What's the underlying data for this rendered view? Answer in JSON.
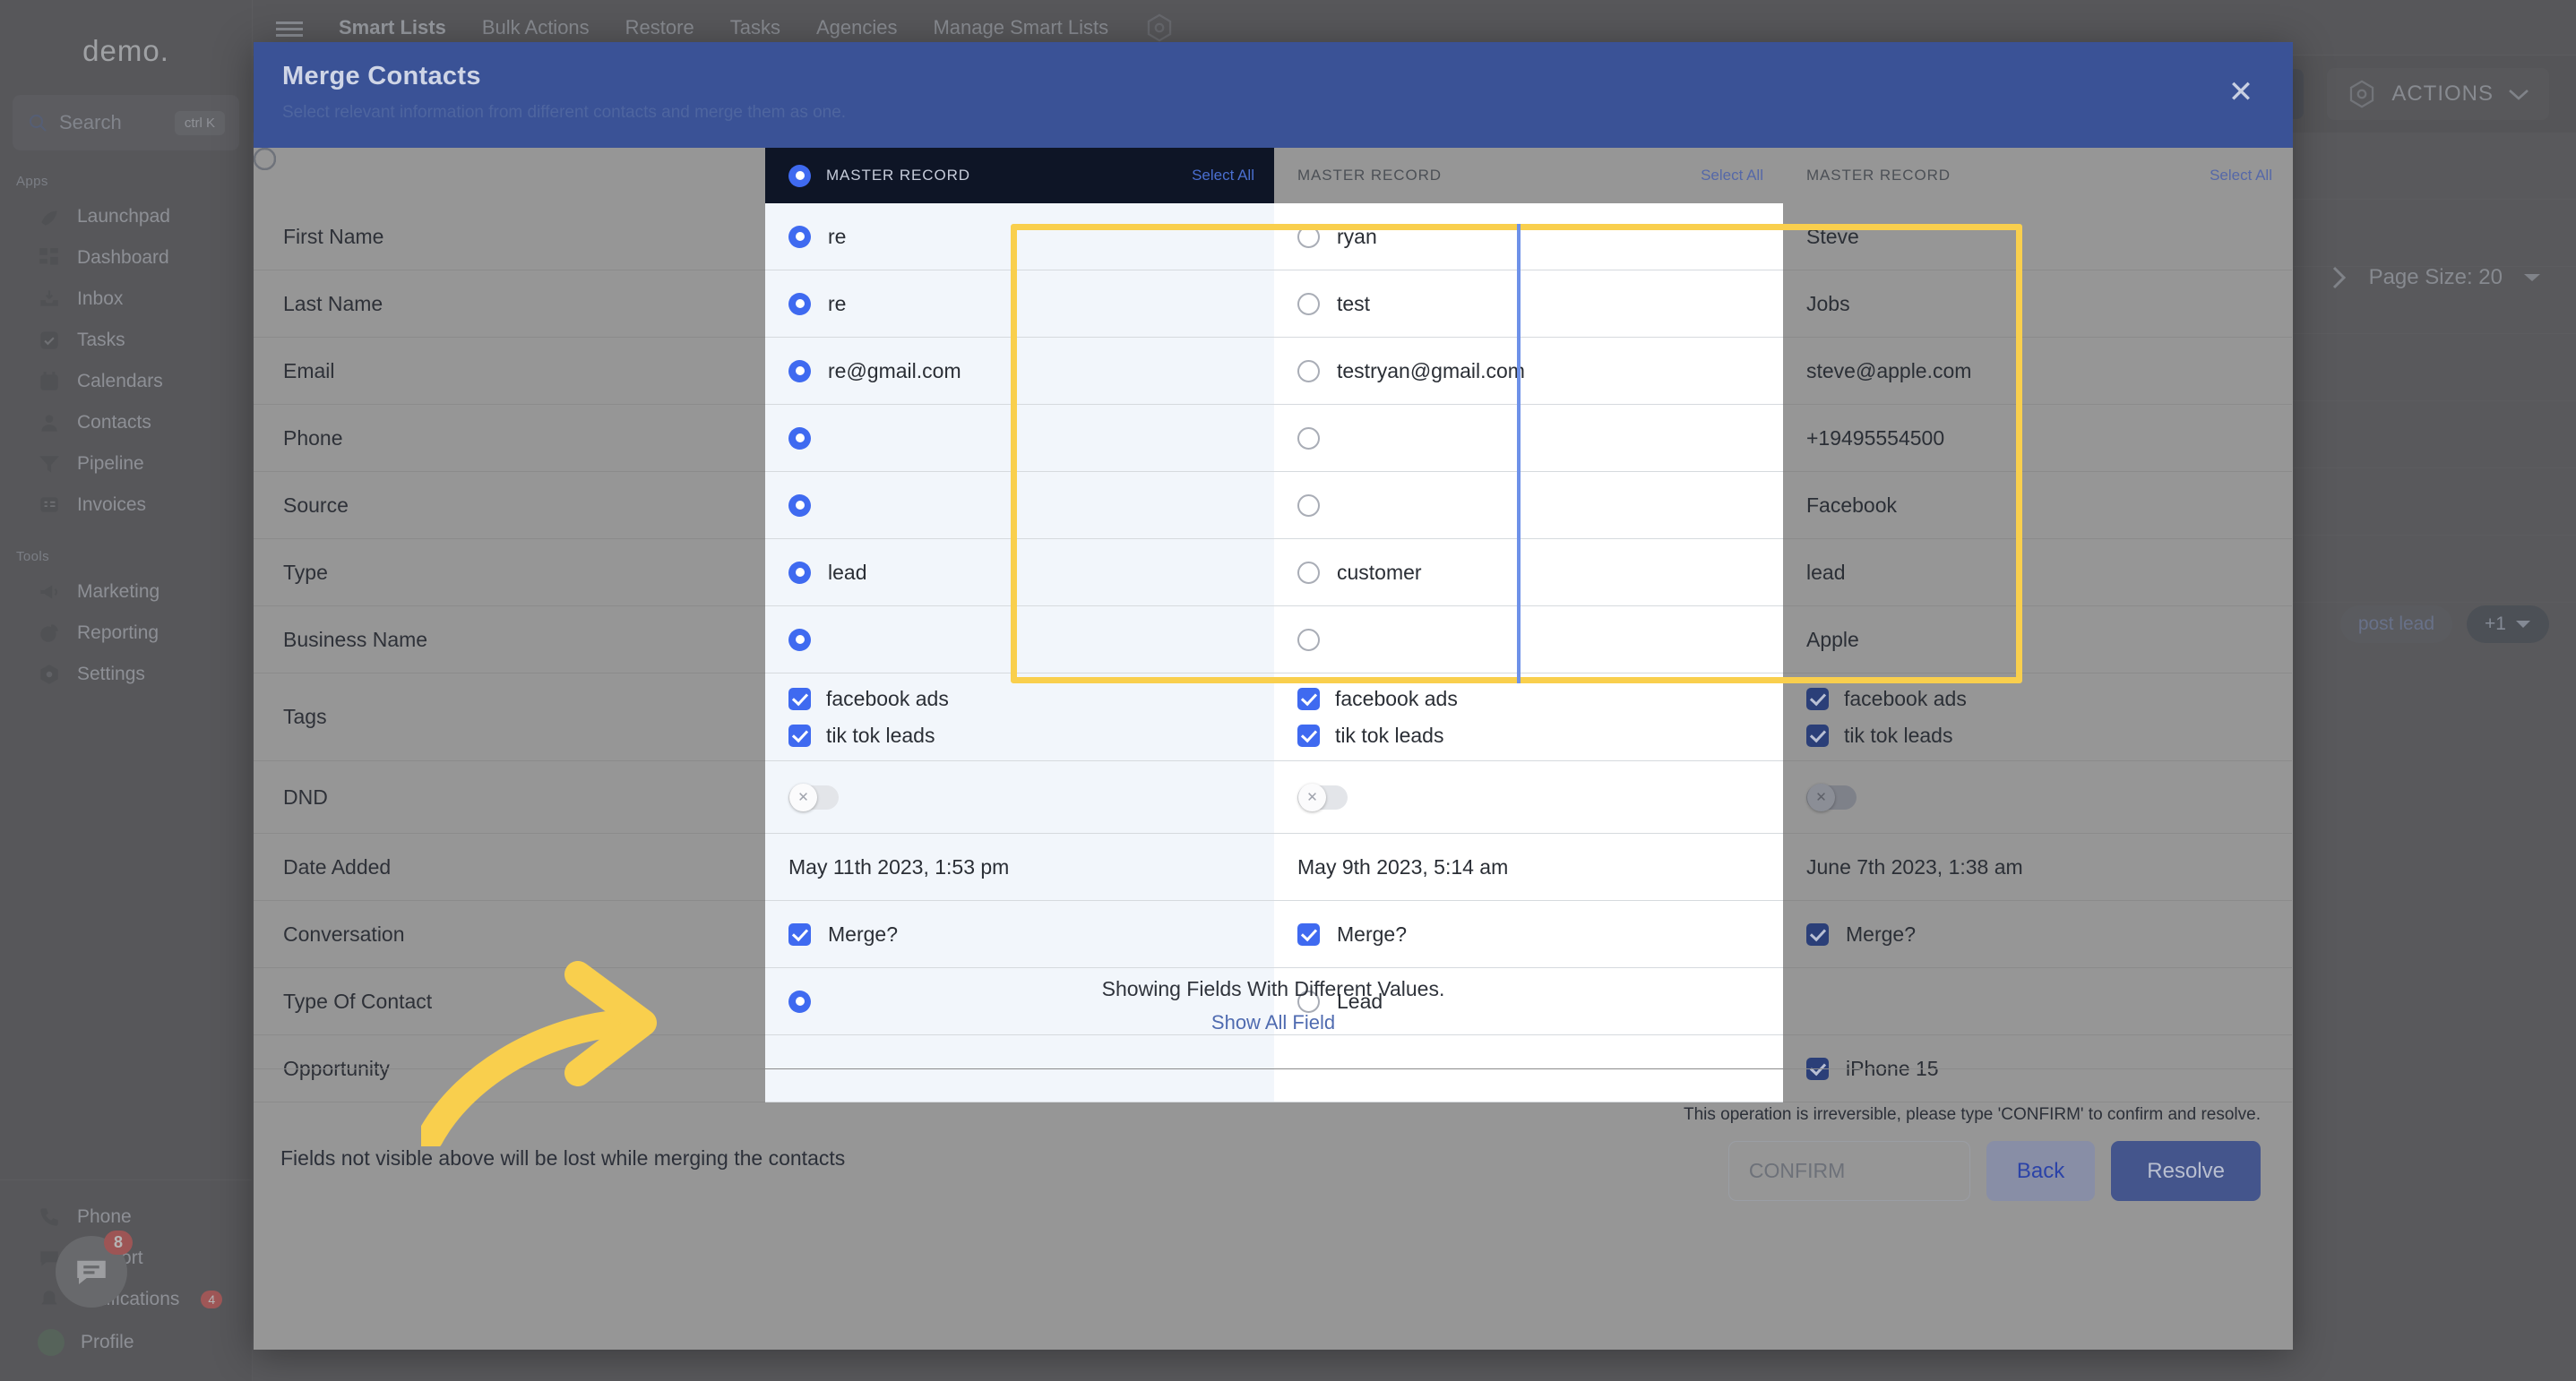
{
  "background": {
    "brand": "demo.",
    "search": {
      "placeholder": "Search",
      "shortcut": "ctrl K",
      "icon": "search-icon"
    },
    "sections": [
      {
        "label": "Apps",
        "items": [
          {
            "label": "Launchpad",
            "icon": "rocket-icon"
          },
          {
            "label": "Dashboard",
            "icon": "grid-icon"
          },
          {
            "label": "Inbox",
            "icon": "inbox-icon"
          },
          {
            "label": "Tasks",
            "icon": "check-square-icon"
          },
          {
            "label": "Calendars",
            "icon": "calendar-icon"
          },
          {
            "label": "Contacts",
            "icon": "person-icon"
          },
          {
            "label": "Pipeline",
            "icon": "funnel-icon"
          },
          {
            "label": "Invoices",
            "icon": "invoice-icon"
          }
        ]
      },
      {
        "label": "Tools",
        "items": [
          {
            "label": "Marketing",
            "icon": "megaphone-icon"
          },
          {
            "label": "Reporting",
            "icon": "pie-chart-icon"
          },
          {
            "label": "Settings",
            "icon": "gear-icon"
          }
        ]
      }
    ],
    "bottom_items": [
      {
        "label": "Phone",
        "icon": "phone-icon",
        "badge": ""
      },
      {
        "label": "Support",
        "icon": "chat-icon",
        "badge": ""
      },
      {
        "label": "Notifications",
        "icon": "bell-icon",
        "badge": "4"
      },
      {
        "label": "Profile",
        "icon": "avatar-icon",
        "badge": ""
      }
    ],
    "chat_fab_badge": "8",
    "topnav": [
      {
        "label": "Smart Lists",
        "active": true
      },
      {
        "label": "Bulk Actions",
        "active": false
      },
      {
        "label": "Restore",
        "active": false
      },
      {
        "label": "Tasks",
        "active": false
      },
      {
        "label": "Agencies",
        "active": false
      },
      {
        "label": "Manage Smart Lists",
        "active": false
      }
    ],
    "actions_label": "ACTIONS",
    "page_size_label": "Page Size: 20",
    "lead_chip": "post lead",
    "plus_chip": "+1"
  },
  "modal": {
    "title": "Merge Contacts",
    "subtitle": "Select relevant information from different contacts and merge them as one.",
    "close_icon": "close-icon",
    "columns": [
      {
        "header": "MASTER RECORD",
        "select_all": "Select All",
        "selected": true
      },
      {
        "header": "MASTER RECORD",
        "select_all": "Select All",
        "selected": false
      },
      {
        "header": "MASTER RECORD",
        "select_all": "Select All",
        "selected": false
      }
    ],
    "rows": [
      {
        "label": "First Name",
        "type": "radio",
        "values": [
          "re",
          "ryan",
          "Steve"
        ],
        "checked": [
          true,
          false,
          false
        ]
      },
      {
        "label": "Last Name",
        "type": "radio",
        "values": [
          "re",
          "test",
          "Jobs"
        ],
        "checked": [
          true,
          false,
          false
        ]
      },
      {
        "label": "Email",
        "type": "radio",
        "values": [
          "re@gmail.com",
          "testryan@gmail.com",
          "steve@apple.com"
        ],
        "checked": [
          true,
          false,
          false
        ]
      },
      {
        "label": "Phone",
        "type": "radio",
        "values": [
          "",
          "",
          "+19495554500"
        ],
        "checked": [
          true,
          false,
          false
        ]
      },
      {
        "label": "Source",
        "type": "radio",
        "values": [
          "",
          "",
          "Facebook"
        ],
        "checked": [
          true,
          false,
          false
        ]
      },
      {
        "label": "Type",
        "type": "radio",
        "values": [
          "lead",
          "customer",
          "lead"
        ],
        "checked": [
          true,
          false,
          false
        ]
      },
      {
        "label": "Business Name",
        "type": "radio",
        "values": [
          "",
          "",
          "Apple"
        ],
        "checked": [
          true,
          false,
          false
        ]
      },
      {
        "label": "Tags",
        "type": "checkbox-list",
        "lists": [
          [
            "facebook ads",
            "tik tok leads"
          ],
          [
            "facebook ads",
            "tik tok leads"
          ],
          [
            "facebook ads",
            "tik tok leads"
          ]
        ],
        "checked": [
          true,
          true,
          true
        ]
      },
      {
        "label": "DND",
        "type": "toggle",
        "values": [
          "",
          "",
          ""
        ],
        "checked": [
          false,
          false,
          false
        ]
      },
      {
        "label": "Date Added",
        "type": "text",
        "values": [
          "May 11th 2023, 1:53 pm",
          "May 9th 2023, 5:14 am",
          "June 7th 2023, 1:38 am"
        ],
        "checked": [
          false,
          false,
          false
        ]
      },
      {
        "label": "Conversation",
        "type": "checkbox",
        "values": [
          "Merge?",
          "Merge?",
          "Merge?"
        ],
        "checked": [
          true,
          true,
          true
        ]
      },
      {
        "label": "Type Of Contact",
        "type": "radio",
        "values": [
          "",
          "Lead",
          ""
        ],
        "checked": [
          true,
          false,
          false
        ]
      },
      {
        "label": "Opportunity",
        "type": "checkbox",
        "values": [
          "",
          "",
          "iPhone 15"
        ],
        "checked": [
          false,
          false,
          true
        ]
      }
    ],
    "footer": {
      "showing_note": "Showing Fields With Different Values.",
      "show_all_link": "Show All Field",
      "lost_note": "Fields not visible above will be lost while merging the contacts",
      "irreversible_note": "This operation is irreversible, please type 'CONFIRM' to confirm and resolve.",
      "confirm_placeholder": "CONFIRM",
      "confirm_value": "",
      "back_label": "Back",
      "resolve_label": "Resolve"
    }
  },
  "annotation": {
    "arrow_color": "#f9cf4d",
    "highlight_color": "#f9cf4d"
  }
}
